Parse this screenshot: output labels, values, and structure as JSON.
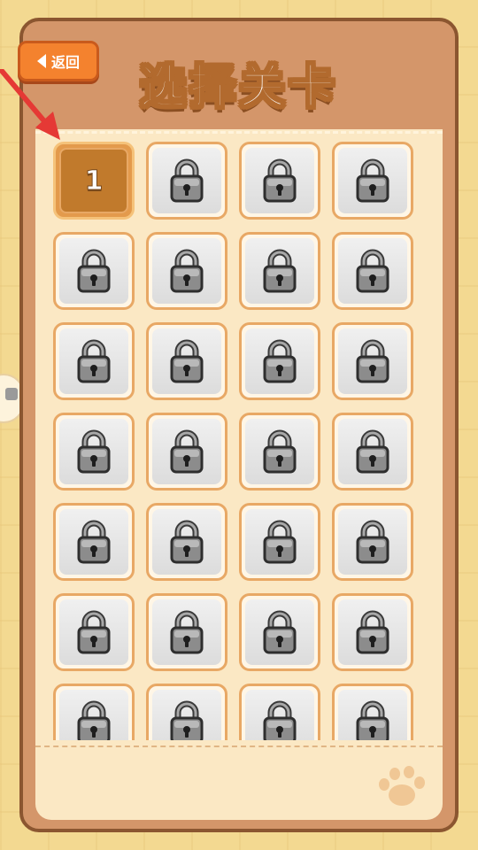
{
  "header": {
    "back_label": "返回",
    "title": "选择关卡"
  },
  "levels": {
    "unlocked_label": "1",
    "total_visible_rows": 7,
    "columns": 4
  },
  "colors": {
    "frame": "#d4966a",
    "frame_border": "#8b5630",
    "panel": "#fbe8c4",
    "back_button": "#f4822e",
    "unlocked_tile": "#c17a2c",
    "locked_tile": "#e6e6e6",
    "tutorial_arrow": "#e53935"
  },
  "icons": {
    "back": "back-arrow-icon",
    "locked": "lock-icon",
    "decoration": "paw-icon",
    "tutorial": "tutorial-arrow-icon"
  }
}
